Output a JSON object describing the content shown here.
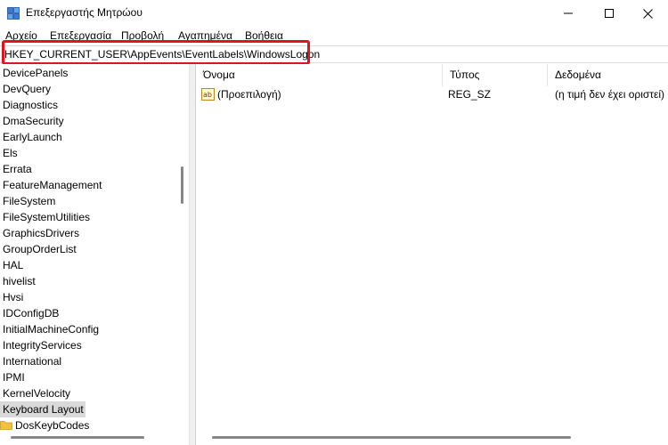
{
  "window": {
    "title": "Επεξεργαστής Μητρώου",
    "icons": {
      "app": "registry-editor-icon",
      "minimize": "minimize-icon",
      "maximize": "maximize-icon",
      "close": "close-icon"
    }
  },
  "menu": {
    "items": [
      "Αρχείο",
      "Επεξεργασία",
      "Προβολή",
      "Αγαπημένα",
      "Βοήθεια"
    ]
  },
  "address": {
    "path": "HKEY_CURRENT_USER\\AppEvents\\EventLabels\\WindowsLogon",
    "highlight_color": "#e0141e"
  },
  "tree": {
    "items": [
      "DevicePanels",
      "DevQuery",
      "Diagnostics",
      "DmaSecurity",
      "EarlyLaunch",
      "Els",
      "Errata",
      "FeatureManagement",
      "FileSystem",
      "FileSystemUtilities",
      "GraphicsDrivers",
      "GroupOrderList",
      "HAL",
      "hivelist",
      "Hvsi",
      "IDConfigDB",
      "InitialMachineConfig",
      "IntegrityServices",
      "International",
      "IPMI",
      "KernelVelocity",
      "Keyboard Layout",
      "DosKeybCodes"
    ],
    "selected": "Keyboard Layout",
    "folder_item": "DosKeybCodes",
    "folder_color": "#f4c042"
  },
  "values": {
    "columns": {
      "name": "Όνομα",
      "type": "Τύπος",
      "data": "Δεδομένα"
    },
    "rows": [
      {
        "icon": "string-value-icon",
        "name": "(Προεπιλογή)",
        "type": "REG_SZ",
        "data": "(η τιμή δεν έχει οριστεί)"
      }
    ]
  }
}
